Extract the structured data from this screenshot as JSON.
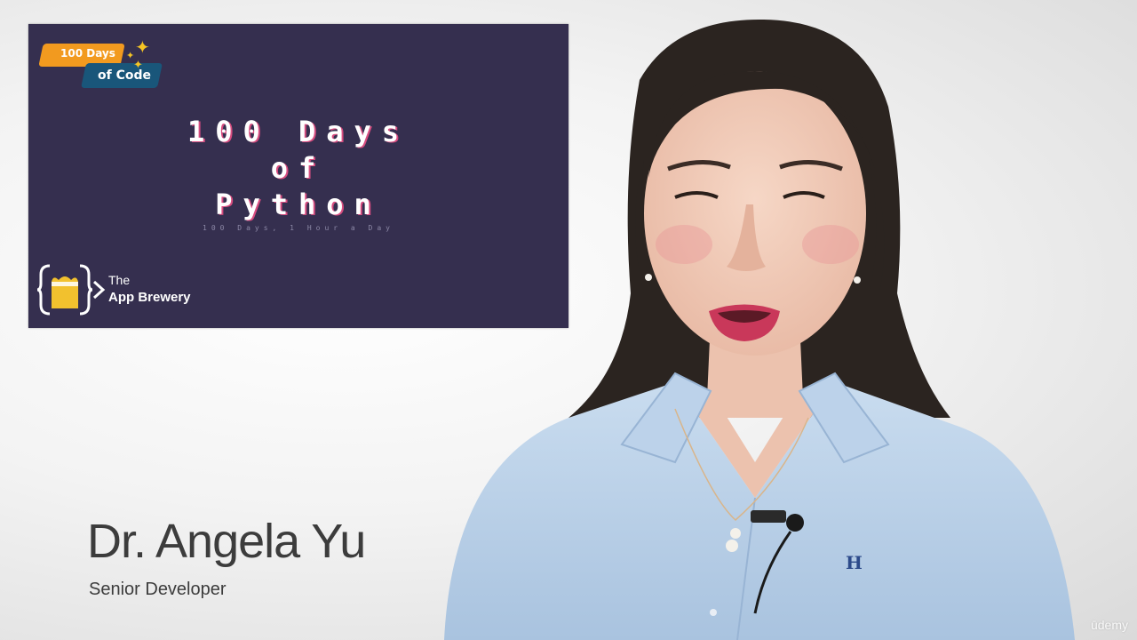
{
  "slide": {
    "badge_line1": "100 Days",
    "badge_line2": "of Code",
    "title_line1": "100 Days",
    "title_line2": "of",
    "title_line3": "Python",
    "subtitle": "100 Days, 1 Hour a Day",
    "brand_line1": "The",
    "brand_line2": "App Brewery",
    "background_color": "#352f4f",
    "title_shadow_color": "#d74d80"
  },
  "presenter": {
    "name": "Dr. Angela Yu",
    "role": "Senior Developer"
  },
  "watermark": "ūdemy"
}
